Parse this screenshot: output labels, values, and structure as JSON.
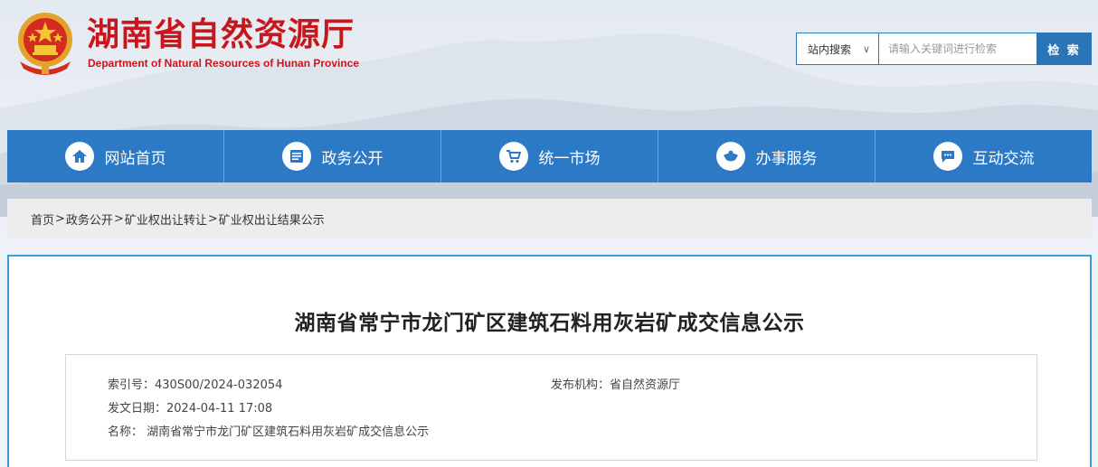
{
  "header": {
    "title": "湖南省自然资源厅",
    "subtitle": "Department of Natural Resources of Hunan Province"
  },
  "search": {
    "scope_label": "站内搜索",
    "placeholder": "请输入关键词进行检索",
    "button_label": "检 索"
  },
  "nav": {
    "items": [
      {
        "label": "网站首页",
        "icon": "home-icon"
      },
      {
        "label": "政务公开",
        "icon": "document-list-icon"
      },
      {
        "label": "统一市场",
        "icon": "shopping-cart-icon"
      },
      {
        "label": "办事服务",
        "icon": "handshake-icon"
      },
      {
        "label": "互动交流",
        "icon": "chat-icon"
      }
    ]
  },
  "breadcrumb": {
    "items": [
      "首页",
      "政务公开",
      "矿业权出让转让",
      "矿业权出让结果公示"
    ],
    "separator": ">"
  },
  "article": {
    "title": "湖南省常宁市龙门矿区建筑石料用灰岩矿成交信息公示",
    "meta": {
      "index_label": "索引号：",
      "index_value": "430S00/2024-032054",
      "publisher_label": "发布机构：",
      "publisher_value": "省自然资源厅",
      "date_label": "发文日期：",
      "date_value": "2024-04-11 17:08",
      "name_label": "名称：",
      "name_value": "湖南省常宁市龙门矿区建筑石料用灰岩矿成交信息公示"
    }
  },
  "colors": {
    "brand_red": "#c8161d",
    "nav_blue": "#2c7ac6",
    "panel_border": "#3a9bd6"
  }
}
